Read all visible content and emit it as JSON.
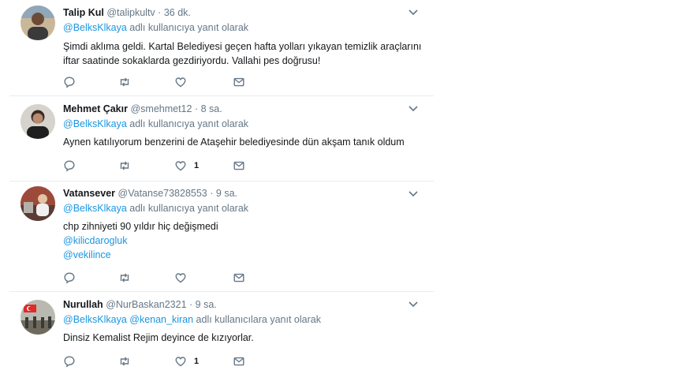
{
  "tweets": [
    {
      "name": "Talip Kul",
      "handle": "@talipkultv",
      "dot": "·",
      "time": "36 dk.",
      "reply_to": "@BelksKlkaya",
      "reply_suffix": " adlı kullanıcıya yanıt olarak",
      "text_lines": [
        "Şimdi aklıma geldi. Kartal Belediyesi geçen hafta yolları yıkayan temizlik araçlarını",
        "iftar saatinde sokaklarda gezdiriyordu. Vallahi pes doğrusu!"
      ],
      "likes": ""
    },
    {
      "name": "Mehmet Çakır",
      "handle": "@smehmet12",
      "dot": "·",
      "time": "8 sa.",
      "reply_to": "@BelksKlkaya",
      "reply_suffix": " adlı kullanıcıya yanıt olarak",
      "text_lines": [
        "Aynen katılıyorum benzerini de Ataşehir belediyesinde dün akşam tanık oldum"
      ],
      "likes": "1"
    },
    {
      "name": "Vatansever",
      "handle": "@Vatanse73828553",
      "dot": "·",
      "time": "9 sa.",
      "reply_to": "@BelksKlkaya",
      "reply_suffix": " adlı kullanıcıya yanıt olarak",
      "text_lines": [
        "chp zihniyeti 90 yıldır hiç değişmedi"
      ],
      "mentions": [
        "@kilicdarogluk",
        "@vekilince"
      ],
      "likes": ""
    },
    {
      "name": "Nurullah",
      "handle": "@NurBaskan2321",
      "dot": "·",
      "time": "9 sa.",
      "reply_to": "@BelksKlkaya",
      "reply_to_2": "@kenan_kiran",
      "reply_suffix": " adlı kullanıcılara yanıt olarak",
      "text_lines": [
        "Dinsiz Kemalist Rejim deyince de kızıyorlar."
      ],
      "likes": "1"
    }
  ],
  "icons": {
    "reply": "reply-icon",
    "retweet": "retweet-icon",
    "like": "heart-icon",
    "dm": "envelope-icon",
    "caret": "chevron-down-icon"
  },
  "colors": {
    "link": "#1b95e0",
    "muted": "#657786",
    "divider": "#e6ecf0"
  }
}
